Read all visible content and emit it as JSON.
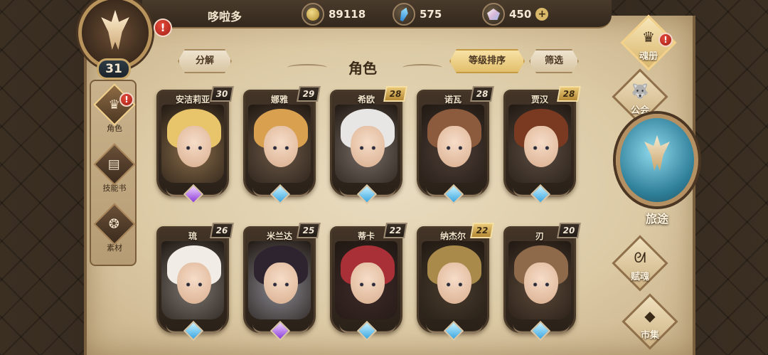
{
  "player": {
    "name": "哆啦多",
    "level": "31"
  },
  "resources": {
    "coins": "89118",
    "crystals": "575",
    "gems": "450",
    "plus": "+"
  },
  "alert_mark": "!",
  "left_nav": [
    {
      "label": "角色",
      "icon": "helmet-icon",
      "glyph": "♛",
      "active": true,
      "alert": true
    },
    {
      "label": "技能书",
      "icon": "book-icon",
      "glyph": "▤",
      "active": false,
      "alert": false
    },
    {
      "label": "素材",
      "icon": "beast-icon",
      "glyph": "❂",
      "active": false,
      "alert": false
    }
  ],
  "toolbar": {
    "decompose": "分解",
    "title": "角色",
    "sort": "等级排序",
    "filter": "筛选"
  },
  "characters": [
    {
      "name": "安洁莉亚",
      "level": "30",
      "gold": false,
      "gem": "purple",
      "hair": "#e8c46a",
      "bg": "#8a6d4a"
    },
    {
      "name": "娜雅",
      "level": "29",
      "gold": false,
      "gem": "blue",
      "hair": "#d9a050",
      "bg": "#6d5a48"
    },
    {
      "name": "希欧",
      "level": "28",
      "gold": true,
      "gem": "blue",
      "hair": "#e8e6e4",
      "bg": "#7a6f68"
    },
    {
      "name": "诺瓦",
      "level": "28",
      "gold": false,
      "gem": "blue",
      "hair": "#8c5a3c",
      "bg": "#4e3f38"
    },
    {
      "name": "贾汉",
      "level": "28",
      "gold": true,
      "gem": "blue",
      "hair": "#7a3a22",
      "bg": "#5d4e42"
    },
    {
      "name": "琉",
      "level": "26",
      "gold": false,
      "gem": "blue",
      "hair": "#f1ece6",
      "bg": "#7e7872"
    },
    {
      "name": "米兰达",
      "level": "25",
      "gold": false,
      "gem": "purple",
      "hair": "#2e2430",
      "bg": "#8a8a92"
    },
    {
      "name": "蒂卡",
      "level": "22",
      "gold": false,
      "gem": "blue",
      "hair": "#a83036",
      "bg": "#3e2a2a"
    },
    {
      "name": "纳杰尔",
      "level": "22",
      "gold": true,
      "gem": "blue",
      "hair": "#a98a4a",
      "bg": "#4a3e2e"
    },
    {
      "name": "刃",
      "level": "20",
      "gold": false,
      "gem": "blue",
      "hair": "#8f6a4a",
      "bg": "#5d4a3a"
    }
  ],
  "right_nav": {
    "soulbook": "魂册",
    "guild": "公会",
    "journey": "旅途",
    "soul": "赋魂",
    "market": "市集"
  }
}
